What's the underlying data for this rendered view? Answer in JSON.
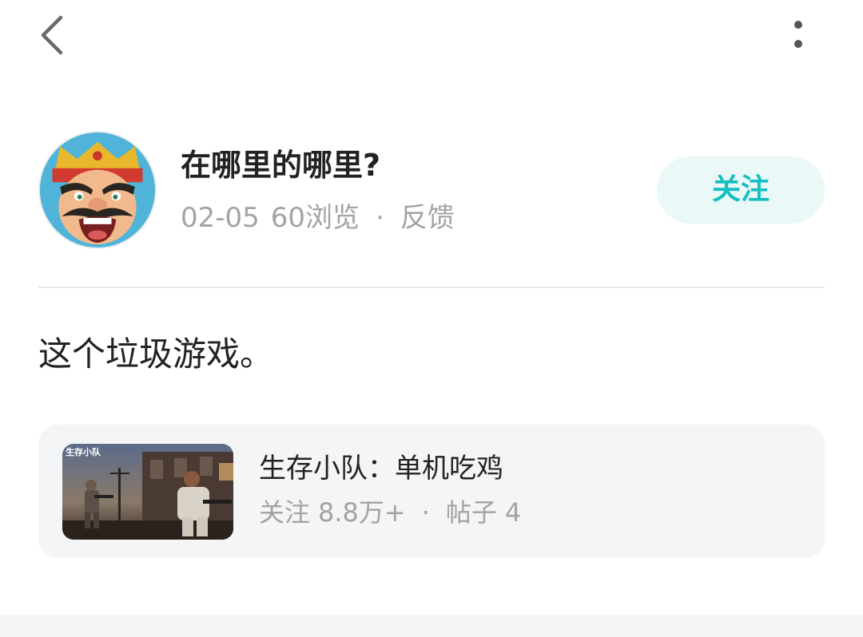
{
  "topbar": {
    "back_icon": "chevron-left-icon",
    "more_icon": "more-vertical-icon"
  },
  "author": {
    "name": "在哪里的哪里?",
    "date": "02-05",
    "views": "60浏览",
    "separator": "·",
    "feedback": "反馈",
    "follow_label": "关注",
    "avatar_icon": "king-character-avatar"
  },
  "post": {
    "text": "这个垃圾游戏。"
  },
  "game_card": {
    "thumb_logo": "生存小队",
    "title": "生存小队：单机吃鸡",
    "follow_label": "关注",
    "follow_count": "8.8万+",
    "separator": "·",
    "posts_label": "帖子",
    "posts_count": "4"
  },
  "colors": {
    "accent": "#14bfbf",
    "follow_bg": "#eaf8f8",
    "text_primary": "#222222",
    "text_secondary": "#a3a3a3",
    "card_bg": "#f4f5f7"
  }
}
